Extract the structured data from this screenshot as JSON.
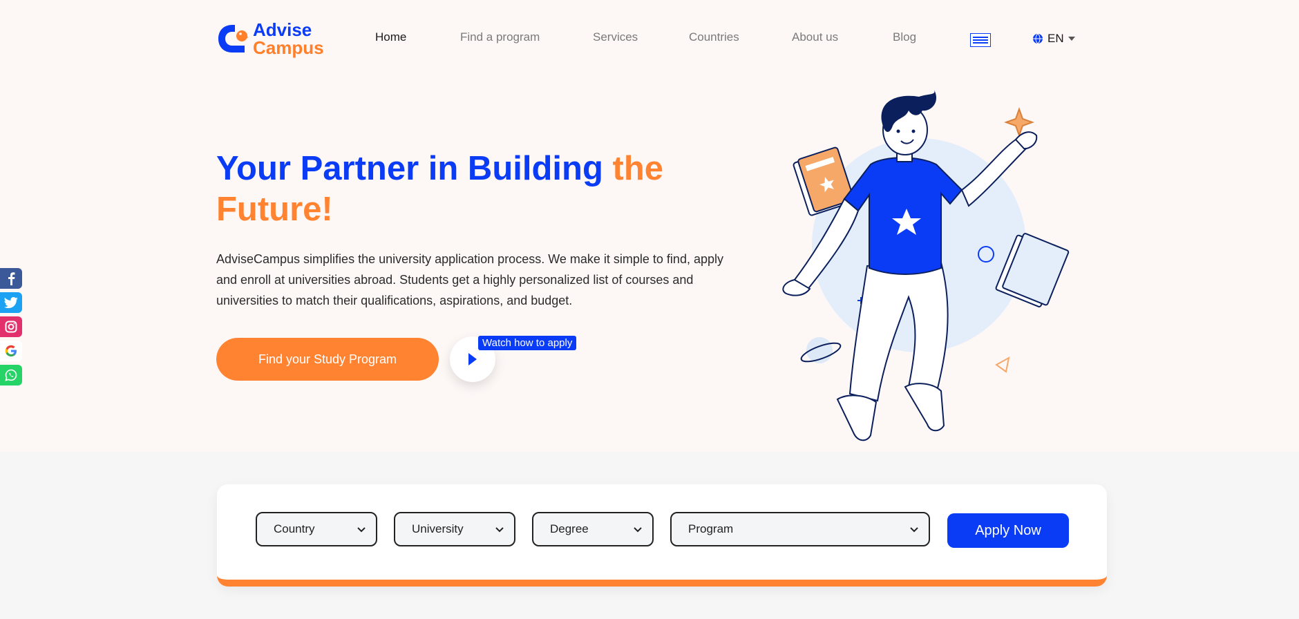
{
  "header": {
    "logo": {
      "line1": "Advise",
      "line2": "Campus"
    },
    "nav": [
      {
        "label": "Home",
        "active": true
      },
      {
        "label": "Find a program",
        "active": false
      },
      {
        "label": "Services",
        "active": false
      },
      {
        "label": "Countries",
        "active": false
      },
      {
        "label": "About us",
        "active": false
      },
      {
        "label": "Blog",
        "active": false
      }
    ],
    "menu_icon": "flag-menu-icon",
    "language": "EN"
  },
  "hero": {
    "title_main": "Your Partner in Building ",
    "title_accent": "the Future!",
    "description": "AdviseCampus simplifies the university application process. We make it simple to find, apply and enroll at universities abroad. Students get a highly personalized list of courses and universities to match their qualifications, aspirations, and budget.",
    "cta_label": "Find your Study Program",
    "watch_label": "Watch how to apply"
  },
  "social": [
    "facebook-icon",
    "twitter-icon",
    "instagram-icon",
    "google-icon",
    "whatsapp-icon"
  ],
  "search": {
    "country": "Country",
    "university": "University",
    "degree": "Degree",
    "program": "Program",
    "apply_label": "Apply Now"
  },
  "colors": {
    "brand_blue": "#0a3bf5",
    "brand_orange": "#ff8331",
    "hero_bg": "#fdf7f6"
  }
}
